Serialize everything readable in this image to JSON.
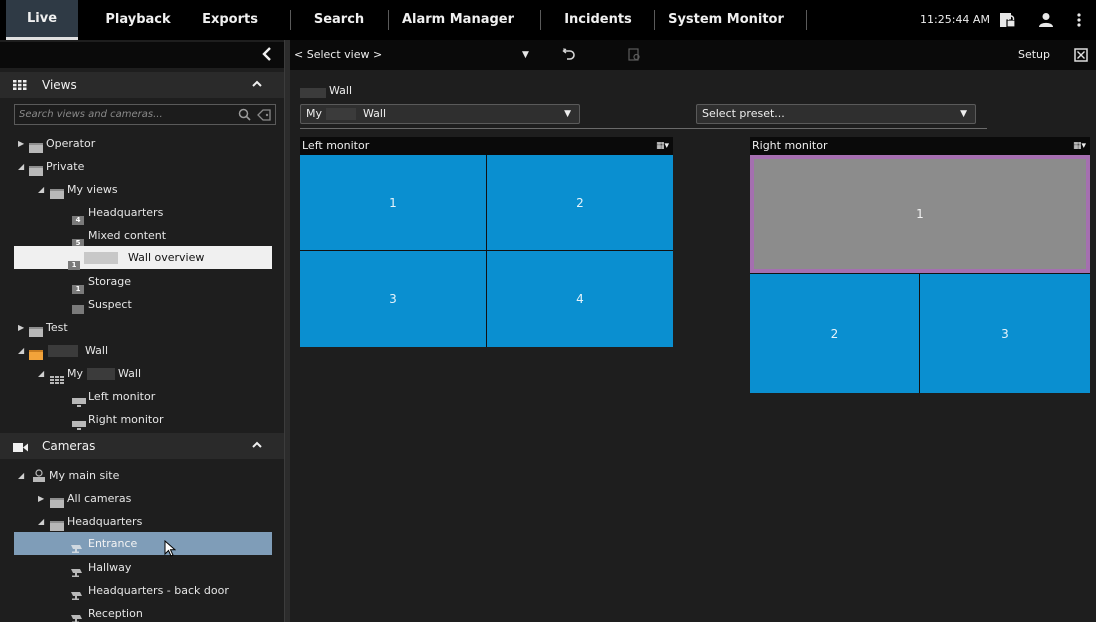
{
  "topbar": {
    "tabs": [
      {
        "label": "Live"
      },
      {
        "label": "Playback"
      },
      {
        "label": "Exports"
      },
      {
        "label": "Search"
      },
      {
        "label": "Alarm Manager"
      },
      {
        "label": "Incidents"
      },
      {
        "label": "System Monitor"
      }
    ],
    "clock": "11:25:44 AM",
    "icons": [
      "clipboard-lock-icon",
      "user-icon",
      "more-vertical-icon"
    ]
  },
  "left_panel": {
    "collapse_icon": "chevron-left-icon",
    "views_section": {
      "title": "Views",
      "search_placeholder": "Search views and cameras...",
      "tree": [
        {
          "label": "Operator"
        },
        {
          "label": "Private"
        },
        {
          "label": "My views"
        },
        {
          "label": "Headquarters",
          "badge": "4"
        },
        {
          "label": "Mixed content",
          "badge": "5"
        },
        {
          "label": "Wall overview",
          "badge": "1"
        },
        {
          "label": "Storage",
          "badge": "1"
        },
        {
          "label": "Suspect"
        },
        {
          "label": "Test"
        },
        {
          "label": "Wall"
        },
        {
          "label": "My",
          "label2": "Wall"
        },
        {
          "label": "Left monitor"
        },
        {
          "label": "Right monitor"
        }
      ]
    },
    "cameras_section": {
      "title": "Cameras",
      "tree": [
        {
          "label": "My main site"
        },
        {
          "label": "All cameras"
        },
        {
          "label": "Headquarters"
        },
        {
          "label": "Entrance"
        },
        {
          "label": "Hallway"
        },
        {
          "label": "Headquarters - back door"
        },
        {
          "label": "Reception"
        }
      ]
    }
  },
  "toolbar": {
    "select_view": "< Select view >",
    "setup": "Setup"
  },
  "main": {
    "wall_title": "Wall",
    "wall_select": {
      "prefix": "My",
      "suffix": "Wall"
    },
    "preset_select": "Select preset...",
    "left_monitor": {
      "title": "Left monitor",
      "tiles": [
        "1",
        "2",
        "3",
        "4"
      ]
    },
    "right_monitor": {
      "title": "Right monitor",
      "tiles": [
        "1",
        "2",
        "3"
      ]
    }
  },
  "colors": {
    "tile_blue": "#0a8fd0",
    "selected_tile_border": "#a56fb0",
    "selected_row": "#7f9db8",
    "folder_orange": "#f2a33a"
  }
}
